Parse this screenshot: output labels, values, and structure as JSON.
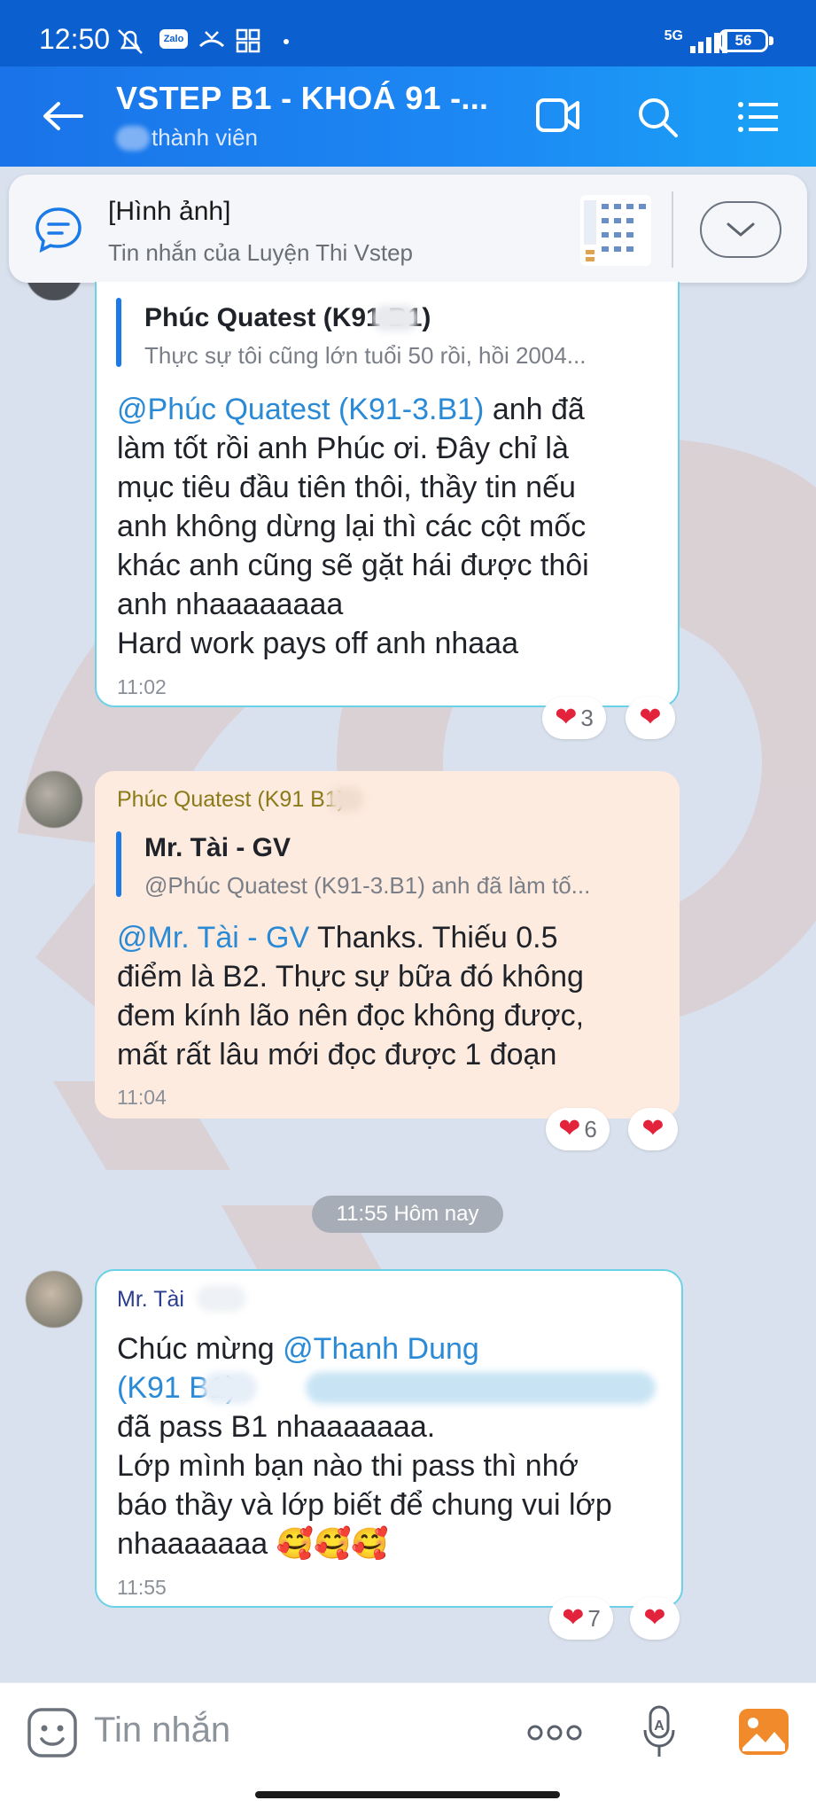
{
  "status_bar": {
    "time": "12:50",
    "network": "5G",
    "battery": "56",
    "icons": [
      "mute-bell-icon",
      "zalo-icon",
      "missed-call-icon",
      "apps-icon"
    ]
  },
  "header": {
    "title": "VSTEP B1 - KHOÁ 91 -...",
    "subtitle": "thành viên",
    "icons": [
      "back-arrow-icon",
      "video-call-icon",
      "search-icon",
      "menu-list-icon"
    ]
  },
  "pinned": {
    "title": "[Hình ảnh]",
    "subtitle": "Tin nhắn của Luyện Thi Vstep"
  },
  "messages": [
    {
      "quote_name": "Phúc Quatest (K91      B1)",
      "quote_text": "Thực sự tôi cũng lớn tuổi 50 rồi, hồi 2004...",
      "mention": "@Phúc Quatest (K91-3.B1)",
      "text_after_mention": " anh đã",
      "lines": [
        "làm tốt rồi anh Phúc ơi. Đây chỉ là",
        "mục tiêu đầu tiên thôi, thầy tin nếu",
        "anh không dừng lại thì các cột mốc",
        "khác anh cũng sẽ gặt hái được thôi",
        "anh nhaaaaaaaa",
        "Hard work pays off anh nhaaa"
      ],
      "time": "11:02",
      "reaction_count": "3"
    },
    {
      "sender": "Phúc Quatest (K91      B1)",
      "quote_name": "Mr. Tài - GV",
      "quote_text": "@Phúc Quatest (K91-3.B1) anh đã làm tố...",
      "mention": "@Mr. Tài - GV",
      "text_after_mention": " Thanks. Thiếu 0.5",
      "lines": [
        "điểm là B2. Thực sự bữa đó không",
        "đem kính lão nên đọc không được,",
        "mất rất lâu mới đọc được 1 đoạn"
      ],
      "time": "11:04",
      "reaction_count": "6"
    },
    {
      "sender": "Mr. Tài",
      "text_before_mention": "Chúc mừng ",
      "mention_line1": "@Thanh Dung",
      "mention_line2": "(K91      B1)",
      "lines": [
        "đã pass B1 nhaaaaaaa.",
        "Lớp mình bạn nào thi pass thì nhớ",
        "báo thầy và lớp biết để chung vui lớp"
      ],
      "last_line": "nhaaaaaaa",
      "emojis": "🥰🥰🥰",
      "time": "11:55",
      "reaction_count": "7"
    }
  ],
  "date_separator": "11:55 Hôm nay",
  "composer": {
    "placeholder": "Tin nhắn",
    "icons": [
      "sticker-icon",
      "more-options-icon",
      "voice-to-text-icon",
      "gallery-icon"
    ]
  },
  "colors": {
    "status_bar": "#0b5fcf",
    "header": "#1a73e8",
    "mention": "#2b8ad6",
    "heart": "#e2233b"
  }
}
